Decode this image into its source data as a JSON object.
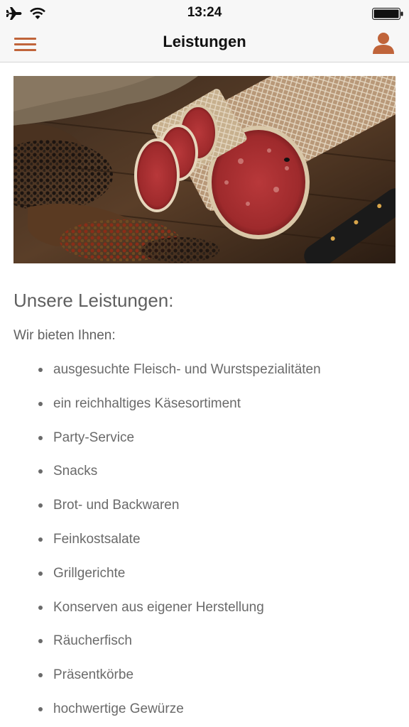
{
  "status_bar": {
    "time": "13:24",
    "icons": [
      "airplane-icon",
      "wifi-icon",
      "battery-icon"
    ]
  },
  "nav": {
    "title": "Leistungen",
    "menu_icon": "hamburger-menu-icon",
    "profile_icon": "user-profile-icon",
    "accent_color": "#c0643a"
  },
  "content": {
    "hero_image": "salami-with-peppercorns-photo",
    "heading": "Unsere Leistungen:",
    "intro": "Wir bieten Ihnen:",
    "services": [
      "ausgesuchte Fleisch- und Wurstspezialitäten",
      "ein reichhaltiges Käsesortiment",
      "Party-Service",
      "Snacks",
      "Brot- und Backwaren",
      "Feinkostsalate",
      "Grillgerichte",
      "Konserven aus eigener Herstellung",
      "Räucherfisch",
      "Präsentkörbe",
      "hochwertige Gewürze"
    ]
  }
}
